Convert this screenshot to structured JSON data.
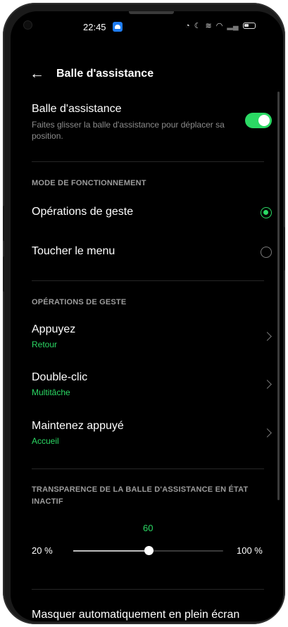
{
  "status_bar": {
    "time": "22:45",
    "app_icon": "app-notification-icon",
    "icons": [
      "alarm-icon",
      "moon-icon",
      "vibrate-icon",
      "wifi-icon",
      "signal-icon",
      "battery-icon"
    ]
  },
  "header": {
    "back_icon": "arrow-left-icon",
    "title": "Balle d'assistance"
  },
  "toggle_row": {
    "title": "Balle d'assistance",
    "description": "Faites glisser la balle d'assistance pour déplacer sa position.",
    "enabled": true
  },
  "mode_section": {
    "header": "MODE DE FONCTIONNEMENT",
    "options": [
      {
        "label": "Opérations de geste",
        "selected": true
      },
      {
        "label": "Toucher le menu",
        "selected": false
      }
    ]
  },
  "gesture_section": {
    "header": "OPÉRATIONS DE GESTE",
    "items": [
      {
        "title": "Appuyez",
        "value": "Retour"
      },
      {
        "title": "Double-clic",
        "value": "Multitâche"
      },
      {
        "title": "Maintenez appuyé",
        "value": "Accueil"
      }
    ]
  },
  "transparency_section": {
    "header": "TRANSPARENCE DE LA BALLE D'ASSISTANCE EN ÉTAT INACTIF",
    "value": "60",
    "min_label": "20 %",
    "max_label": "100 %",
    "min": 20,
    "max": 100,
    "current": 60
  },
  "cut_off_row": {
    "text": "Masquer automatiquement en plein écran"
  },
  "colors": {
    "accent": "#2bd964",
    "background": "#000000",
    "secondary_text": "#8c8c8c"
  }
}
